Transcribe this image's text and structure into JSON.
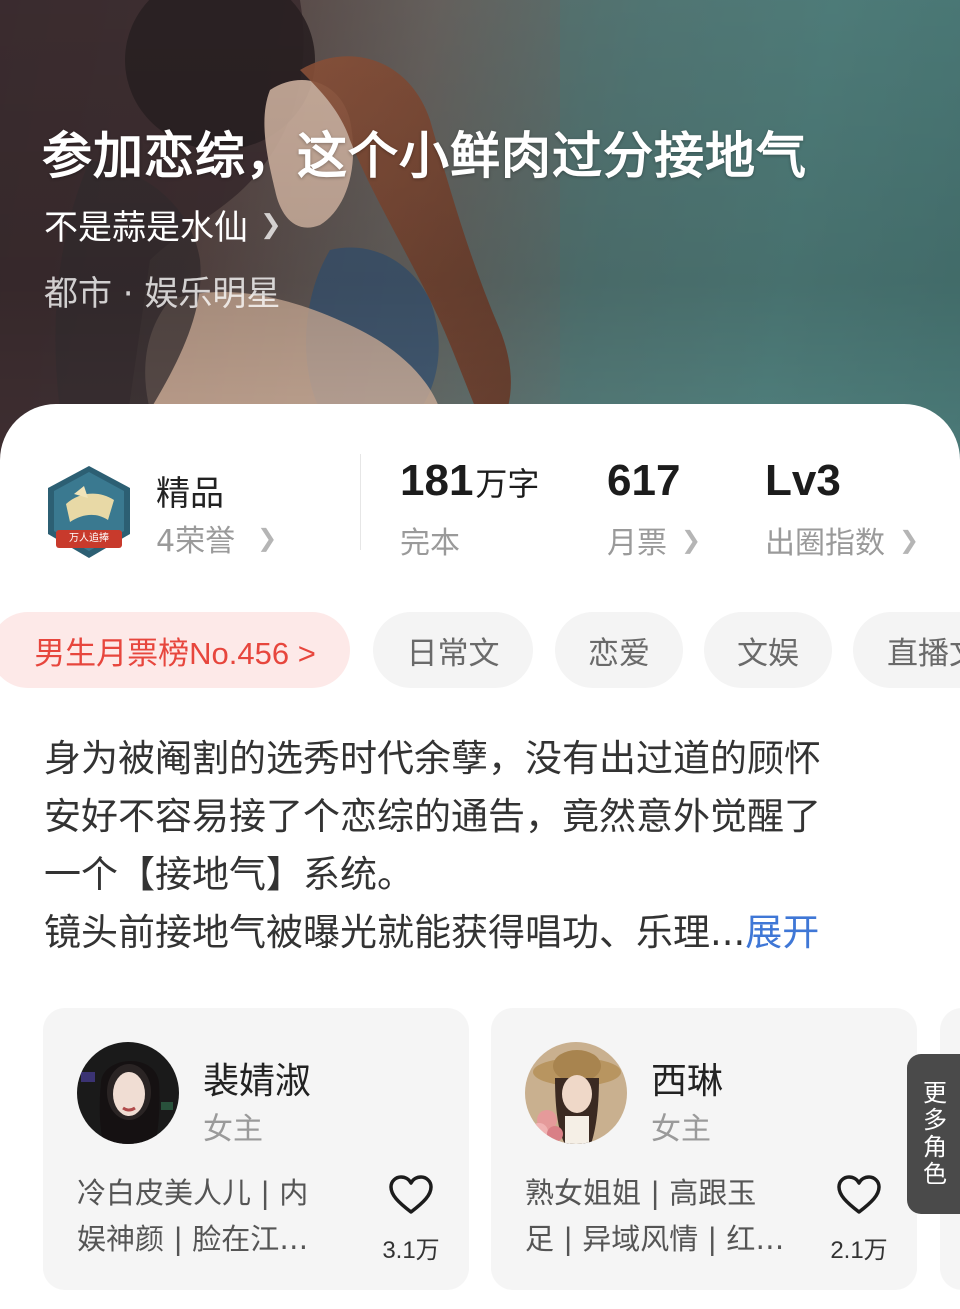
{
  "book": {
    "title": "参加恋综，这个小鲜肉过分接地气",
    "author": "不是蒜是水仙",
    "genre": "都市 · 娱乐明星"
  },
  "honor": {
    "type": "精品",
    "count": "4荣誉",
    "badge_text": "万人追捧"
  },
  "stats": {
    "words_value": "181",
    "words_unit": "万字",
    "words_label": "完本",
    "votes_value": "617",
    "votes_label": "月票",
    "index_value": "Lv3",
    "index_label": "出圈指数"
  },
  "tags": {
    "rank": "男生月票榜No.456 >",
    "items": [
      "日常文",
      "恋爱",
      "文娱",
      "直播文"
    ]
  },
  "synopsis": {
    "lines": [
      "身为被阉割的选秀时代余孽，没有出过道的顾怀",
      "安好不容易接了个恋综的通告，竟然意外觉醒了",
      "一个【接地气】系统。",
      "镜头前接地气被曝光就能获得唱功、乐理..."
    ],
    "expand_label": "展开"
  },
  "characters": [
    {
      "name": "裴婧淑",
      "role": "女主",
      "desc_lines": [
        "冷白皮美人儿 | 内",
        "娱神颜 | 脸在江…"
      ],
      "likes": "3.1万"
    },
    {
      "name": "西琳",
      "role": "女主",
      "desc_lines": [
        "熟女姐姐 | 高跟玉",
        "足 | 异域风情 | 红…"
      ],
      "likes": "2.1万"
    }
  ],
  "more_roles": [
    "更",
    "多",
    "角",
    "色"
  ],
  "icons": {
    "author_chevron": "chevron-right-icon",
    "like": "heart-outline-icon",
    "badge": "honor-badge-icon"
  },
  "colors": {
    "rank_tag_bg": "#fde9e8",
    "rank_tag_text": "#e7463d",
    "expand_link": "#3f77d6",
    "tag_bg": "#f4f4f4",
    "more_roles_bg": "#4a4a4a"
  }
}
